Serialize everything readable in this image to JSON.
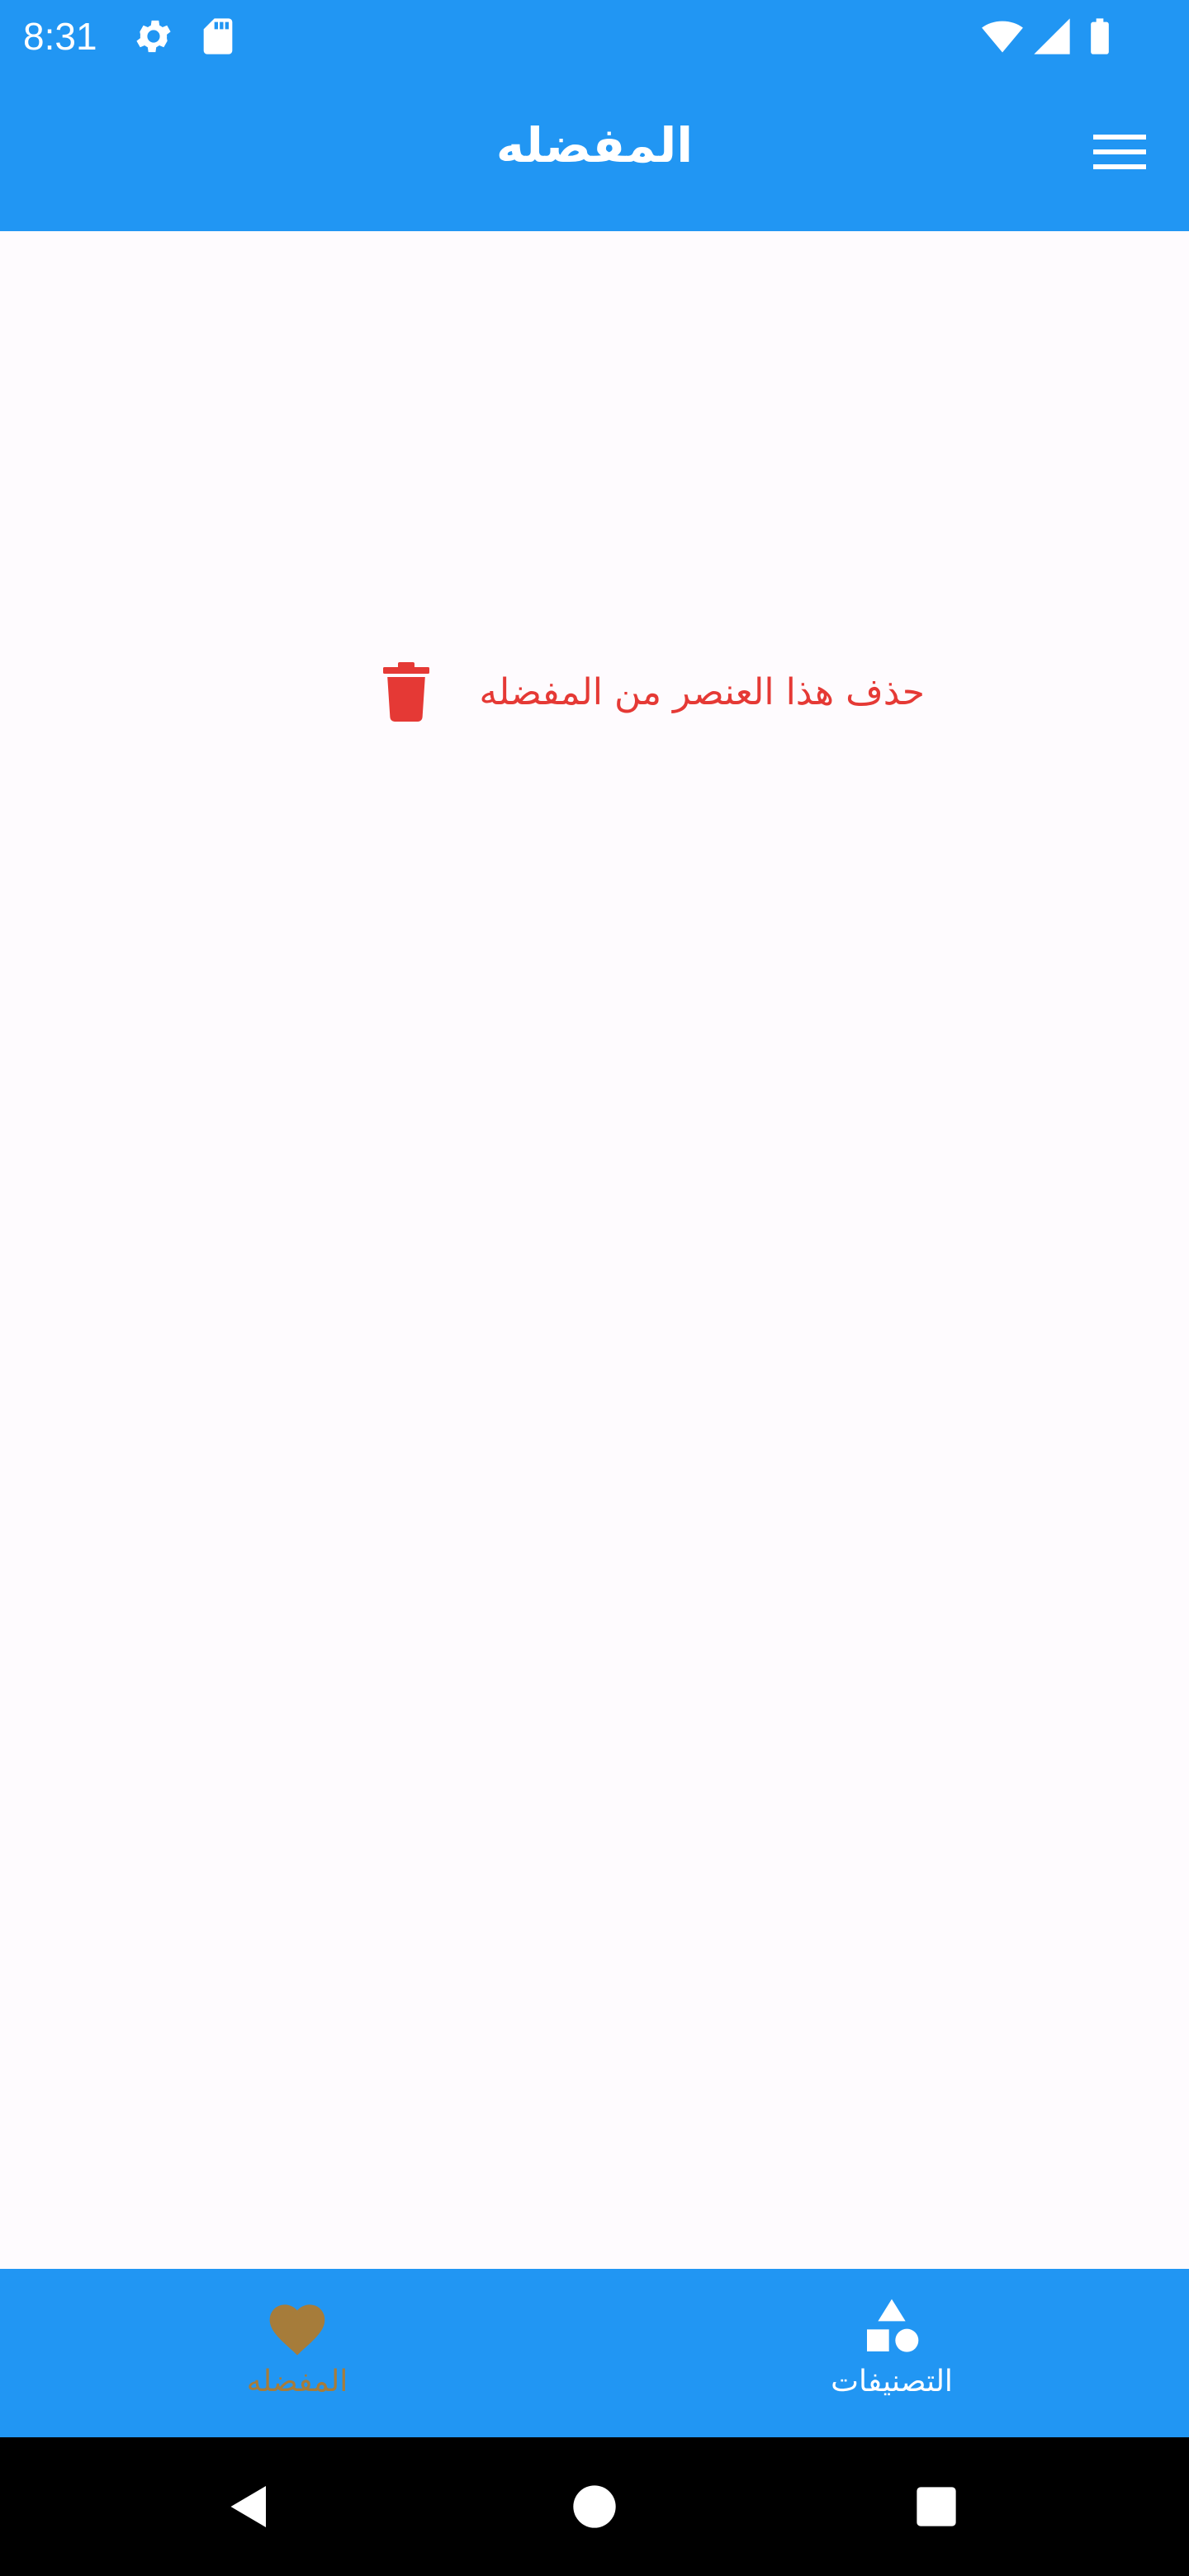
{
  "status_bar": {
    "time": "8:31",
    "icons": [
      "settings-icon",
      "sd-card-icon",
      "wifi-icon",
      "signal-icon",
      "battery-icon"
    ]
  },
  "app_bar": {
    "title": "المفضله",
    "menu_icon": "menu-icon"
  },
  "content": {
    "delete_action": {
      "label": "حذف هذا العنصر من المفضله",
      "icon": "trash-icon",
      "color": "#e53935"
    }
  },
  "bottom_nav": {
    "items": [
      {
        "label": "المفضله",
        "icon": "heart-icon",
        "selected": true,
        "color": "#a67c3a"
      },
      {
        "label": "التصنيفات",
        "icon": "category-shapes-icon",
        "selected": false,
        "color": "#ffffff"
      }
    ]
  },
  "system_nav": {
    "buttons": [
      "back-icon",
      "home-icon",
      "recents-icon"
    ]
  },
  "colors": {
    "primary": "#2196f3",
    "background": "#fefbfe",
    "accent_selected": "#a67c3a",
    "danger": "#e53935"
  }
}
